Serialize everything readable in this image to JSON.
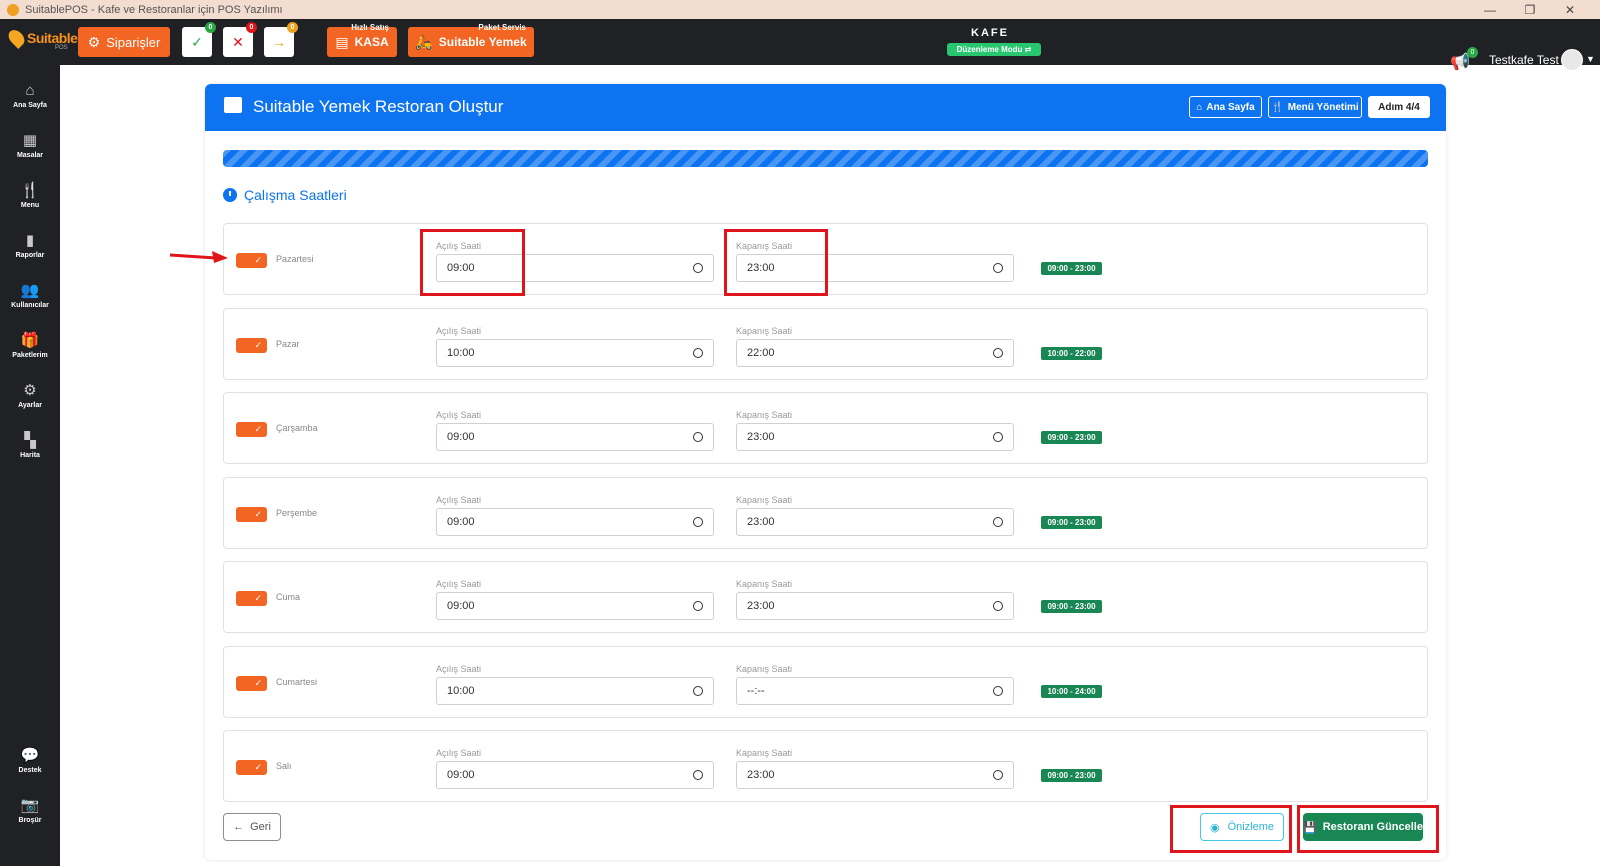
{
  "window": {
    "title": "SuitablePOS - Kafe ve Restoranlar için POS Yazılımı",
    "controls": [
      "—",
      "❐",
      "✕"
    ]
  },
  "navbar": {
    "logo_text": "Suitable",
    "logo_sub": "POS",
    "orders_label": "Siparişler",
    "approved_badge": "0",
    "cancelled_badge": "0",
    "forward_badge": "0",
    "kasa_top": "Hızlı Satış",
    "kasa_label": "KASA",
    "yemek_top": "Paket Servis",
    "yemek_label": "Suitable Yemek",
    "venue": "KAFE",
    "edit_mode": "Düzenleme Modu ⇄",
    "notif_badge": "0",
    "user": "Testkafe Test"
  },
  "sidebar": {
    "items": [
      {
        "label": "Ana Sayfa",
        "icon": "home-icon"
      },
      {
        "label": "Masalar",
        "icon": "tables-icon"
      },
      {
        "label": "Menu",
        "icon": "cutlery-icon"
      },
      {
        "label": "Raporlar",
        "icon": "report-icon"
      },
      {
        "label": "Kullanıcılar",
        "icon": "users-icon"
      },
      {
        "label": "Paketlerim",
        "icon": "gift-icon"
      },
      {
        "label": "Ayarlar",
        "icon": "gears-icon"
      },
      {
        "label": "Harita",
        "icon": "map-icon"
      }
    ],
    "bottom": [
      {
        "label": "Destek",
        "icon": "chat-icon"
      },
      {
        "label": "Broşür",
        "icon": "camera-icon"
      }
    ]
  },
  "card": {
    "title": "Suitable Yemek Restoran Oluştur",
    "home_btn": "Ana Sayfa",
    "menu_btn": "Menü Yönetimi",
    "step": "Adım 4/4",
    "progress": 1.0,
    "section": "Çalışma Saatleri",
    "open_label": "Açılış Saati",
    "close_label": "Kapanış Saati",
    "days": [
      {
        "name": "Pazartesi",
        "open": "09:00",
        "close": "23:00",
        "range": "09:00 - 23:00"
      },
      {
        "name": "Pazar",
        "open": "10:00",
        "close": "22:00",
        "range": "10:00 - 22:00"
      },
      {
        "name": "Çarşamba",
        "open": "09:00",
        "close": "23:00",
        "range": "09:00 - 23:00"
      },
      {
        "name": "Perşembe",
        "open": "09:00",
        "close": "23:00",
        "range": "09:00 - 23:00"
      },
      {
        "name": "Cuma",
        "open": "09:00",
        "close": "23:00",
        "range": "09:00 - 23:00"
      },
      {
        "name": "Cumartesi",
        "open": "10:00",
        "close": "--:--",
        "range": "10:00 - 24:00"
      },
      {
        "name": "Salı",
        "open": "09:00",
        "close": "23:00",
        "range": "09:00 - 23:00"
      }
    ],
    "back_btn": "Geri",
    "preview_btn": "Önizleme",
    "update_btn": "Restoranı Güncelle"
  },
  "colors": {
    "accent": "#f26522",
    "primary": "#0d73f0",
    "success": "#198754",
    "highlight": "#e0141b"
  }
}
